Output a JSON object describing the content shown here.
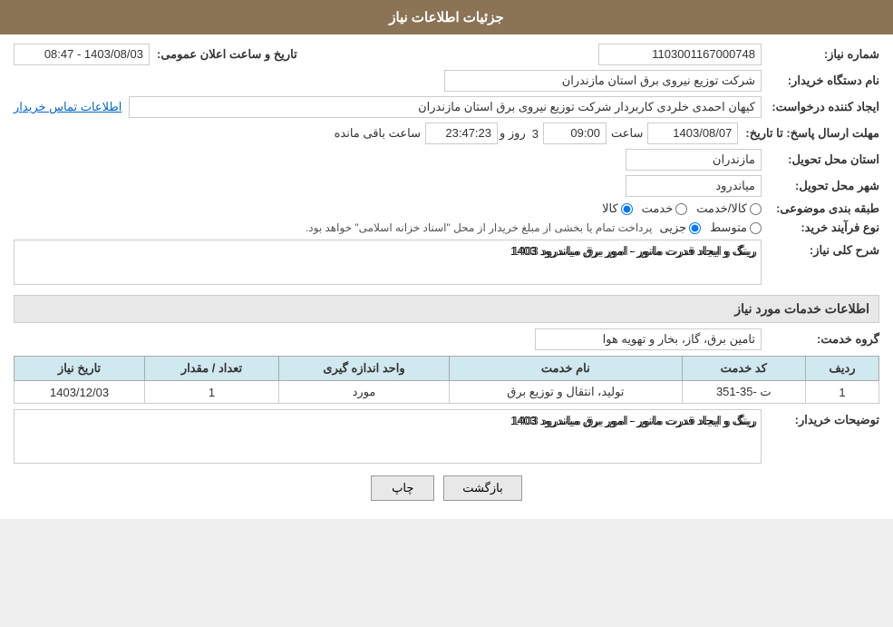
{
  "header": {
    "title": "جزئیات اطلاعات نیاز"
  },
  "fields": {
    "need_number_label": "شماره نیاز:",
    "need_number_value": "1103001167000748",
    "announcement_date_label": "تاریخ و ساعت اعلان عمومی:",
    "announcement_date_value": "1403/08/03 - 08:47",
    "buyer_org_label": "نام دستگاه خریدار:",
    "buyer_org_value": "شرکت توزیع نیروی برق استان مازندران",
    "requester_label": "ایجاد کننده درخواست:",
    "requester_value": "کیهان احمدی خلردی کاربردار شرکت توزیع نیروی برق استان مازندران",
    "contact_link": "اطلاعات تماس خریدار",
    "response_deadline_label": "مهلت ارسال پاسخ: تا تاریخ:",
    "response_date": "1403/08/07",
    "response_time_label": "ساعت",
    "response_time": "09:00",
    "remaining_days_label": "روز و",
    "remaining_days": "3",
    "remaining_time": "23:47:23",
    "remaining_suffix": "ساعت باقی مانده",
    "province_label": "استان محل تحویل:",
    "province_value": "مازندران",
    "city_label": "شهر محل تحویل:",
    "city_value": "میاندرود",
    "category_label": "طبقه بندی موضوعی:",
    "category_options": [
      "کالا",
      "خدمت",
      "کالا/خدمت"
    ],
    "category_selected": "کالا",
    "purchase_type_label": "نوع فرآیند خرید:",
    "purchase_type_options": [
      "جزیی",
      "متوسط"
    ],
    "purchase_type_selected": "جزیی",
    "purchase_type_note": "پرداخت تمام یا بخشی از مبلغ خریدار از محل \"اسناد خزانه اسلامی\" خواهد بود.",
    "need_description_label": "شرح کلی نیاز:",
    "need_description_value": "رینگ و ایجاد قدرت مانور - امور برق میاندرود 1403"
  },
  "services_section": {
    "title": "اطلاعات خدمات مورد نیاز",
    "service_group_label": "گروه خدمت:",
    "service_group_value": "تامین برق، گاز، بخار و تهویه هوا",
    "table": {
      "columns": [
        "ردیف",
        "کد خدمت",
        "نام خدمت",
        "واحد اندازه گیری",
        "تعداد / مقدار",
        "تاریخ نیاز"
      ],
      "rows": [
        {
          "row": "1",
          "code": "ت -35-351",
          "name": "تولید، انتقال و توزیع برق",
          "unit": "مورد",
          "quantity": "1",
          "date": "1403/12/03"
        }
      ]
    }
  },
  "buyer_description_label": "توضیحات خریدار:",
  "buyer_description_value": "رینگ و ایجاد قدرت مانور - امور برق میاندرود 1403",
  "buttons": {
    "print": "چاپ",
    "back": "بازگشت"
  }
}
